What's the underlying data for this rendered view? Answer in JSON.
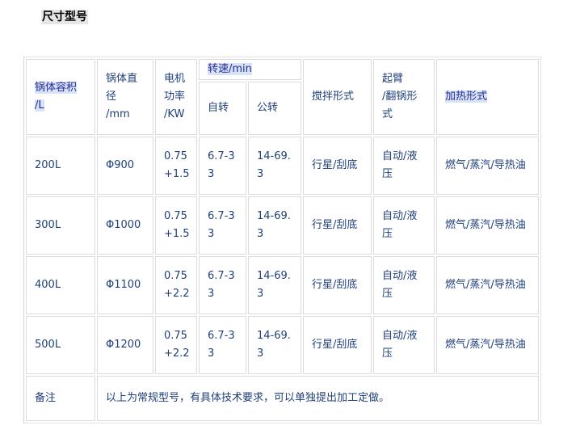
{
  "page_title": "尺寸型号",
  "table": {
    "headers": {
      "capacity": [
        "锅体容积",
        "/L"
      ],
      "diameter": [
        "锅体直",
        "径",
        "/mm"
      ],
      "power": [
        "电机",
        "功率",
        "/KW"
      ],
      "speed": "转速/min",
      "self_rotation": "自转",
      "revolution": "公转",
      "stirring": "搅拌形式",
      "tilt": [
        "起臂",
        "/翻锅形",
        "式"
      ],
      "heating": "加热形式"
    },
    "rows": [
      {
        "capacity": "200L",
        "diameter": "Φ900",
        "power": [
          "0.75",
          "+1.5"
        ],
        "self_rotation": [
          "6.7-3",
          "3"
        ],
        "revolution": [
          "14-69.",
          "3"
        ],
        "stirring": "行星/刮底",
        "tilt": [
          "自动/液",
          "压"
        ],
        "heating": "燃气/蒸汽/导热油"
      },
      {
        "capacity": "300L",
        "diameter": "Φ1000",
        "power": [
          "0.75",
          "+1.5"
        ],
        "self_rotation": [
          "6.7-3",
          "3"
        ],
        "revolution": [
          "14-69.",
          "3"
        ],
        "stirring": "行星/刮底",
        "tilt": [
          "自动/液",
          "压"
        ],
        "heating": "燃气/蒸汽/导热油"
      },
      {
        "capacity": "400L",
        "diameter": "Φ1100",
        "power": [
          "0.75",
          "+2.2"
        ],
        "self_rotation": [
          "6.7-3",
          "3"
        ],
        "revolution": [
          "14-69.",
          "3"
        ],
        "stirring": "行星/刮底",
        "tilt": [
          "自动/液",
          "压"
        ],
        "heating": "燃气/蒸汽/导热油"
      },
      {
        "capacity": "500L",
        "diameter": "Φ1200",
        "power": [
          "0.75",
          "+2.2"
        ],
        "self_rotation": [
          "6.7-3",
          "3"
        ],
        "revolution": [
          "14-69.",
          "3"
        ],
        "stirring": "行星/刮底",
        "tilt": [
          "自动/液",
          "压"
        ],
        "heating": "燃气/蒸汽/导热油"
      }
    ],
    "note_label": "备注",
    "note_text": "以上为常规型号，有具体技术要求，可以单独提出加工定做。"
  }
}
